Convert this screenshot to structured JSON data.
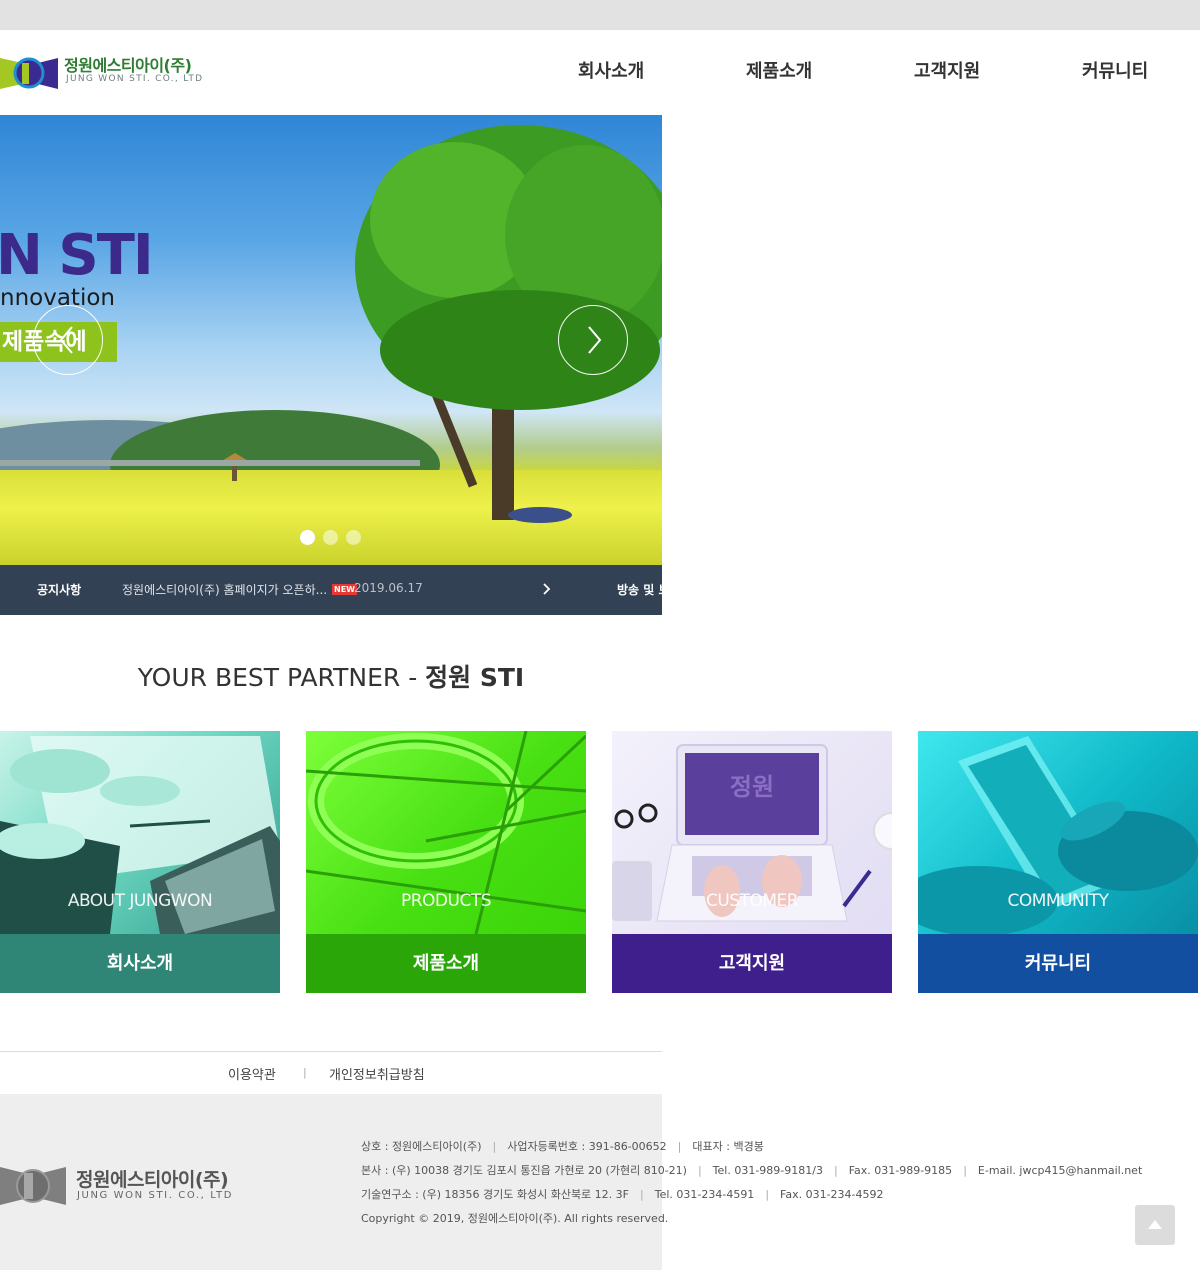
{
  "header": {
    "logo_name": "정원에스티아이(주)",
    "logo_sub": "JUNG WON STI. CO., LTD",
    "nav": [
      "회사소개",
      "제품소개",
      "고객지원",
      "커뮤니티"
    ]
  },
  "hero": {
    "title": "N STI",
    "subtitle": "nnovation",
    "tag": "제품속에",
    "slide_count": 3,
    "active_slide": 1
  },
  "notice": {
    "label": "공지사항",
    "text": "정원에스티아이(주) 홈페이지가 오픈하...",
    "badge": "NEW",
    "date": "2019.06.17",
    "label2": "방송 및 보"
  },
  "partner": {
    "prefix": "YOUR BEST PARTNER - ",
    "highlight": "정원 STI"
  },
  "cards": [
    {
      "en": "ABOUT JUNGWON",
      "ko": "회사소개",
      "color": "#2f8676"
    },
    {
      "en": "PRODUCTS",
      "ko": "제품소개",
      "color": "#2ba608"
    },
    {
      "en": "CUSTOMER",
      "ko": "고객지원",
      "color": "#3e1f8c"
    },
    {
      "en": "COMMUNITY",
      "ko": "커뮤니티",
      "color": "#134fa0"
    }
  ],
  "laptop_screen_text": "정원",
  "footer": {
    "links": [
      "이용약관",
      "개인정보취급방침"
    ],
    "logo_name": "정원에스티아이(주)",
    "logo_sub": "JUNG WON STI. CO., LTD",
    "line1": [
      "상호 : 정원에스티아이(주)",
      "사업자등록번호 : 391-86-00652",
      "대표자 : 백경봉"
    ],
    "line2": [
      "본사 : (우) 10038 경기도 김포시 통진읍 가현로 20 (가현리 810-21)",
      "Tel. 031-989-9181/3",
      "Fax. 031-989-9185",
      "E-mail. jwcp415@hanmail.net"
    ],
    "line3": [
      "기술연구소 : (우) 18356 경기도 화성시 화산북로 12. 3F",
      "Tel. 031-234-4591",
      "Fax. 031-234-4592"
    ],
    "copyright": "Copyright © 2019, 정원에스티아이(주). All rights reserved."
  }
}
